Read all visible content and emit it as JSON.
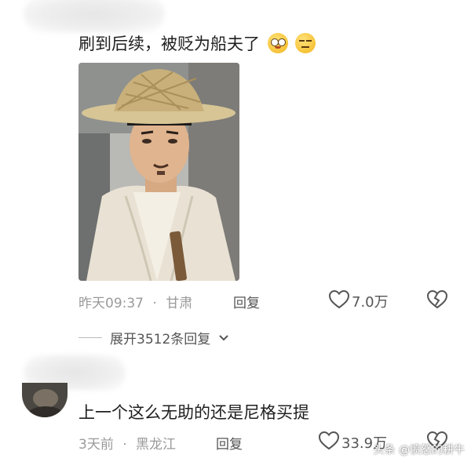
{
  "comment1": {
    "text": "刷到后续，被贬为船夫了",
    "emojis": [
      "blush-emoji",
      "smirk-emoji"
    ],
    "time": "昨天09:37",
    "location": "甘肃",
    "separator": "·",
    "reply_label": "回复",
    "likes": "7.0万"
  },
  "expand": {
    "label": "展开3512条回复"
  },
  "comment2": {
    "text": "上一个这么无助的还是尼格买提",
    "time": "3天前",
    "location": "黑龙江",
    "separator": "·",
    "reply_label": "回复",
    "likes": "33.9万"
  },
  "watermark": "头条 @愤怒的耕牛",
  "colors": {
    "meta": "#9a9a9a",
    "text": "#1f1f1f",
    "icon": "#555555"
  }
}
